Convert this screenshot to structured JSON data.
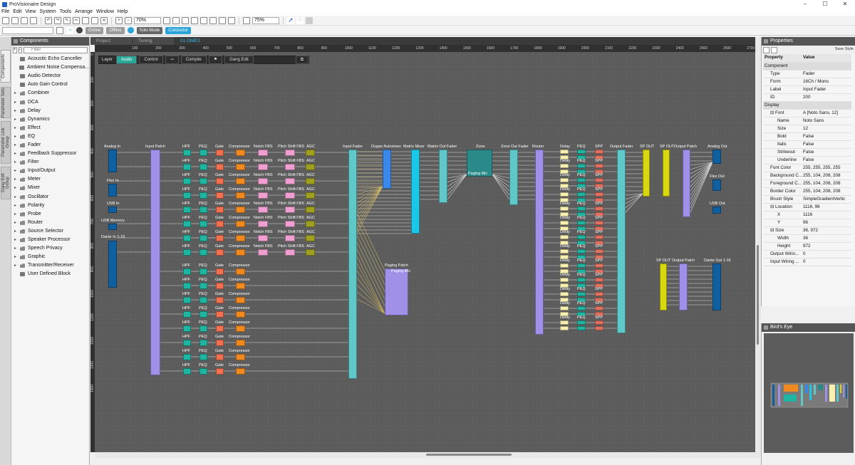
{
  "window": {
    "title": "ProVisionaire Design"
  },
  "menu": [
    "File",
    "Edit",
    "View",
    "System",
    "Tools",
    "Arrange",
    "Window",
    "Help"
  ],
  "toolbar": {
    "zoom": "70%",
    "zoom2": "75%"
  },
  "toolbar2": {
    "online": "Online",
    "offline": "Offline",
    "solo": "Solo Mode",
    "conductor": "Conductor"
  },
  "components_panel": {
    "title": "Components",
    "filter_placeholder": "Filter",
    "items": [
      {
        "label": "Acoustic Echo Canceller",
        "folder": false
      },
      {
        "label": "Ambient Noise Compensa...",
        "folder": false
      },
      {
        "label": "Audio Detector",
        "folder": false
      },
      {
        "label": "Auto Gain Control",
        "folder": false
      },
      {
        "label": "Combiner",
        "folder": true
      },
      {
        "label": "DCA",
        "folder": true
      },
      {
        "label": "Delay",
        "folder": true
      },
      {
        "label": "Dynamics",
        "folder": true
      },
      {
        "label": "Effect",
        "folder": true
      },
      {
        "label": "EQ",
        "folder": true
      },
      {
        "label": "Fader",
        "folder": true
      },
      {
        "label": "Feedback Suppressor",
        "folder": true
      },
      {
        "label": "Filter",
        "folder": true
      },
      {
        "label": "Input/Output",
        "folder": true
      },
      {
        "label": "Meter",
        "folder": true
      },
      {
        "label": "Mixer",
        "folder": true
      },
      {
        "label": "Oscillator",
        "folder": true
      },
      {
        "label": "Polarity",
        "folder": true
      },
      {
        "label": "Probe",
        "folder": true
      },
      {
        "label": "Router",
        "folder": true
      },
      {
        "label": "Source Selector",
        "folder": true
      },
      {
        "label": "Speaker Processor",
        "folder": true
      },
      {
        "label": "Speech Privacy",
        "folder": true
      },
      {
        "label": "Graphic",
        "folder": true
      },
      {
        "label": "Transmitter/Receiver",
        "folder": true
      },
      {
        "label": "User Defined Block",
        "folder": false
      }
    ]
  },
  "side_tabs": [
    "Components",
    "Parameter Sets",
    "Parameter Link Group",
    "Gang Edit Group"
  ],
  "design_tabs": [
    "Project",
    "Tuning",
    "01 OME3"
  ],
  "ruler_h": [
    "100",
    "200",
    "300",
    "400",
    "500",
    "600",
    "700",
    "800",
    "900",
    "1000",
    "1100",
    "1200",
    "1300",
    "1400",
    "1500",
    "1600",
    "1700",
    "1800",
    "1900",
    "2000",
    "2100",
    "2200",
    "2300",
    "2400",
    "2500",
    "2600",
    "2700",
    "2800"
  ],
  "ruler_v": [
    "0",
    "100",
    "200",
    "300",
    "400",
    "500",
    "600",
    "700",
    "800",
    "900",
    "1000",
    "1100",
    "1200",
    "1300",
    "1400"
  ],
  "layer_bar": {
    "layer": "Layer",
    "audio": "Audio",
    "control": "Control",
    "compile": "Compile",
    "gang": "Gang Edit"
  },
  "blocks": {
    "analog_in": "Analog In",
    "flex_in": "Flex In",
    "usb_in": "USB In",
    "usb_memory": "USB Memory",
    "dante_in": "Dante In 1-16",
    "input_patch": "Input Patch",
    "hpf": "HPF",
    "peq": "PEQ",
    "gate": "Gate",
    "compressor": "Compressor",
    "notch": "Notch FBS",
    "pitch": "Pitch Shift FBS",
    "agc": "AGC",
    "input_fader": "Input Fader",
    "dugan": "Dugan Automixer",
    "matrix_mixer": "Matrix Mixer",
    "matrix_out": "Matrix Out Fader",
    "zone": "Zone",
    "zone_inner": "Paging Mic",
    "zone_out": "Zone Out Fader",
    "router": "Router",
    "delay": "Delay",
    "spp": "SPP",
    "output_fader": "Output Fader",
    "sp_out": "SP OUT",
    "output_patch": "Output Patch",
    "analog_out": "Analog Out",
    "flex_out": "Flex Out",
    "usb_out": "USB Out",
    "dante_out": "Dante Out 1-16",
    "paging_patch": "Paging Patch",
    "paging_inner": "Paging Mic"
  },
  "properties": {
    "title": "Properties",
    "save_style": "Save Style",
    "col_property": "Property",
    "col_value": "Value",
    "rows": [
      {
        "k": "Component",
        "v": "",
        "type": "sec"
      },
      {
        "k": "Type",
        "v": "Fader",
        "type": "sub"
      },
      {
        "k": "Form",
        "v": "16Ch / Mono",
        "type": "sub"
      },
      {
        "k": "Label",
        "v": "Input Fader",
        "type": "sub"
      },
      {
        "k": "ID",
        "v": "200",
        "type": "sub"
      },
      {
        "k": "Display",
        "v": "",
        "type": "sec"
      },
      {
        "k": "⊟ Font",
        "v": "A [Noto Sans, 12]",
        "type": "sub"
      },
      {
        "k": "Name",
        "v": "Noto Sans",
        "type": "ind"
      },
      {
        "k": "Size",
        "v": "12",
        "type": "ind"
      },
      {
        "k": "Bold",
        "v": "False",
        "type": "ind"
      },
      {
        "k": "Italic",
        "v": "False",
        "type": "ind"
      },
      {
        "k": "Strikeout",
        "v": "False",
        "type": "ind"
      },
      {
        "k": "Underline",
        "v": "False",
        "type": "ind"
      },
      {
        "k": "Font Color",
        "v": "255, 255, 255, 255",
        "type": "sub"
      },
      {
        "k": "Background C...",
        "v": "255, 104, 208, 208",
        "type": "sub"
      },
      {
        "k": "Foreground C...",
        "v": "255, 104, 208, 208",
        "type": "sub"
      },
      {
        "k": "Border Color",
        "v": "255, 104, 208, 208",
        "type": "sub"
      },
      {
        "k": "Brush Style",
        "v": "SimpleGradientVertic",
        "type": "sub"
      },
      {
        "k": "⊟ Location",
        "v": "1116, 96",
        "type": "sub"
      },
      {
        "k": "X",
        "v": "1116",
        "type": "ind"
      },
      {
        "k": "Y",
        "v": "96",
        "type": "ind"
      },
      {
        "k": "⊟ Size",
        "v": "36, 972",
        "type": "sub"
      },
      {
        "k": "Width",
        "v": "36",
        "type": "ind"
      },
      {
        "k": "Height",
        "v": "972",
        "type": "ind"
      },
      {
        "k": "Output Wirin...",
        "v": "0",
        "type": "sub"
      },
      {
        "k": "Input Wiring ...",
        "v": "0",
        "type": "sub"
      }
    ]
  },
  "birds_eye": {
    "title": "Bird's Eye"
  },
  "colors": {
    "hpf": "#1fb5a0",
    "peq": "#1fb5a0",
    "gate": "#f07050",
    "comp": "#f08a20",
    "notch": "#f0a0d0",
    "pitch": "#f0a0d0",
    "agc": "#a0a020",
    "patch": "#a090e8",
    "fader": "#60c8c8",
    "io": "#1060a0",
    "matrix": "#1cc8e8",
    "dugan": "#3a88e8",
    "delay": "#f8f0b0",
    "spp": "#e07060",
    "sp": "#d8d810",
    "zone": "#2a8a8a"
  }
}
